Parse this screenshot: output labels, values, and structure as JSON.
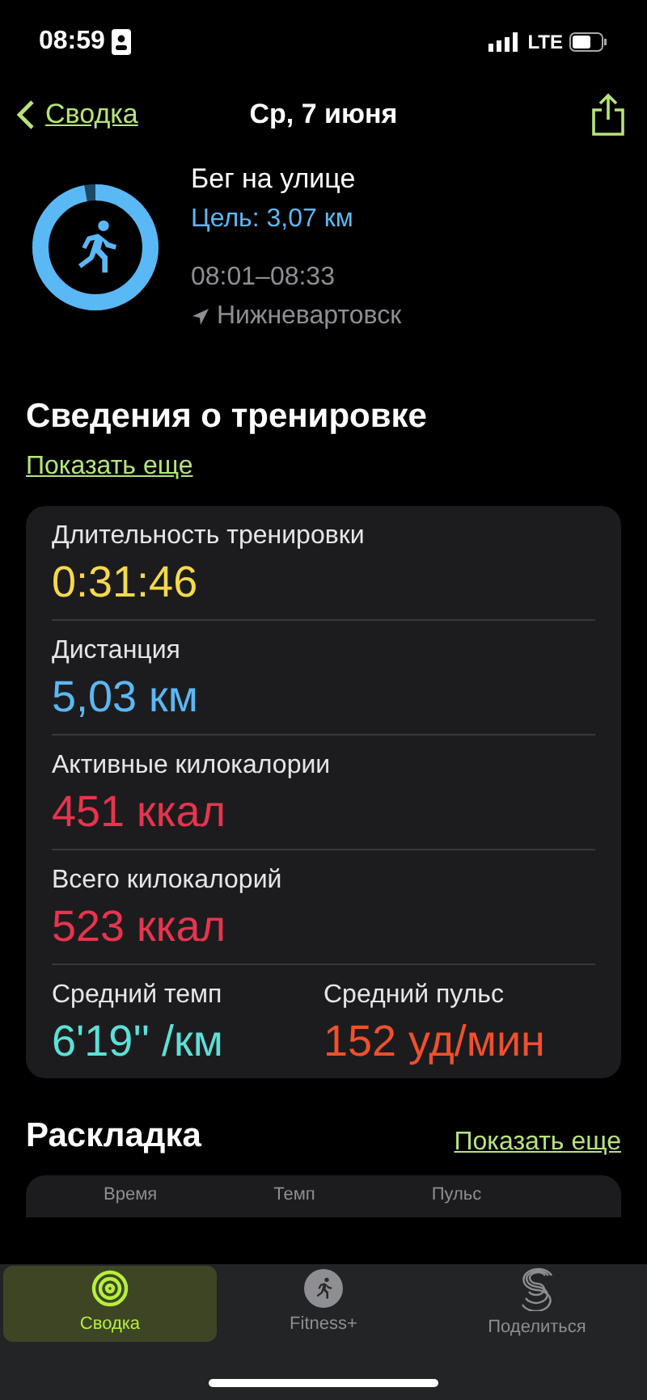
{
  "status_bar": {
    "time": "08:59",
    "network": "LTE"
  },
  "nav": {
    "back": "Сводка",
    "title": "Ср, 7 июня"
  },
  "workout": {
    "name": "Бег на улице",
    "goal": "Цель: 3,07 км",
    "time": "08:01–08:33",
    "location": "Нижневартовск"
  },
  "details": {
    "title": "Сведения о тренировке",
    "more": "Показать еще",
    "rows": [
      {
        "items": [
          {
            "label": "Длительность тренировки",
            "value": "0:31:46",
            "color": "#f5d94a"
          }
        ]
      },
      {
        "items": [
          {
            "label": "Дистанция",
            "value": "5,03 км",
            "color": "#5ab8f5"
          }
        ]
      },
      {
        "items": [
          {
            "label": "Активные килокалории",
            "value": "451 ккал",
            "color": "#e8344e"
          }
        ]
      },
      {
        "items": [
          {
            "label": "Всего килокалорий",
            "value": "523 ккал",
            "color": "#e8344e"
          }
        ]
      },
      {
        "items": [
          {
            "label": "Средний темп",
            "value": "6'19'' /км",
            "color": "#5ce0d8"
          },
          {
            "label": "Средний пульс",
            "value": "152 уд/мин",
            "color": "#f0502c"
          }
        ]
      }
    ]
  },
  "splits": {
    "title": "Раскладка",
    "more": "Показать еще",
    "columns": [
      "Время",
      "Темп",
      "Пульс"
    ]
  },
  "tabs": [
    {
      "label": "Сводка",
      "selected": true,
      "kind": "rings"
    },
    {
      "label": "Fitness+",
      "selected": false,
      "kind": "runner"
    },
    {
      "label": "Поделиться",
      "selected": false,
      "kind": "share"
    }
  ]
}
